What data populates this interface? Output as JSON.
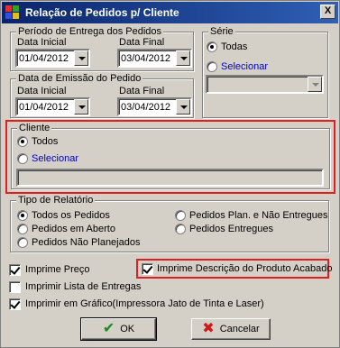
{
  "window": {
    "title": "Relação de Pedidos p/ Cliente",
    "close_glyph": "X"
  },
  "colors": {
    "title_bar": "#0a246a",
    "highlight_box": "#e02020",
    "link": "#0000cc",
    "ok_check": "#1a8a1a",
    "cancel_x": "#d01818"
  },
  "icons": {
    "app": "app-icon",
    "ok": "check-icon",
    "cancel": "cancel-x-icon"
  },
  "periodo_entrega": {
    "legend": "Período de Entrega dos Pedidos",
    "data_inicial_label": "Data Inicial",
    "data_final_label": "Data Final",
    "data_inicial": "01/04/2012",
    "data_final": "03/04/2012"
  },
  "data_emissao": {
    "legend": "Data de Emissão do Pedido",
    "data_inicial_label": "Data Inicial",
    "data_final_label": "Data Final",
    "data_inicial": "01/04/2012",
    "data_final": "03/04/2012"
  },
  "serie": {
    "legend": "Série",
    "todas": "Todas",
    "selecionar": "Selecionar",
    "selected": "todas",
    "combo_value": ""
  },
  "cliente": {
    "legend": "Cliente",
    "todos": "Todos",
    "selecionar": "Selecionar",
    "selected": "todos",
    "value": ""
  },
  "tipo_relatorio": {
    "legend": "Tipo de Relatório",
    "options": [
      "Todos os Pedidos",
      "Pedidos em Aberto",
      "Pedidos Não Planejados",
      "Pedidos Plan. e Não Entregues",
      "Pedidos Entregues"
    ],
    "selected": "Todos os Pedidos"
  },
  "checks": {
    "imprime_preco": {
      "label": "Imprime Preço",
      "checked": true
    },
    "imprime_descricao": {
      "label": "Imprime Descrição do Produto Acabado",
      "checked": true
    },
    "imprimir_lista": {
      "label": "Imprimir Lista de Entregas",
      "checked": false
    },
    "imprimir_grafico": {
      "label": "Imprimir em Gráfico(Impressora Jato de Tinta e Laser)",
      "checked": true
    }
  },
  "buttons": {
    "ok": "OK",
    "cancelar": "Cancelar"
  }
}
